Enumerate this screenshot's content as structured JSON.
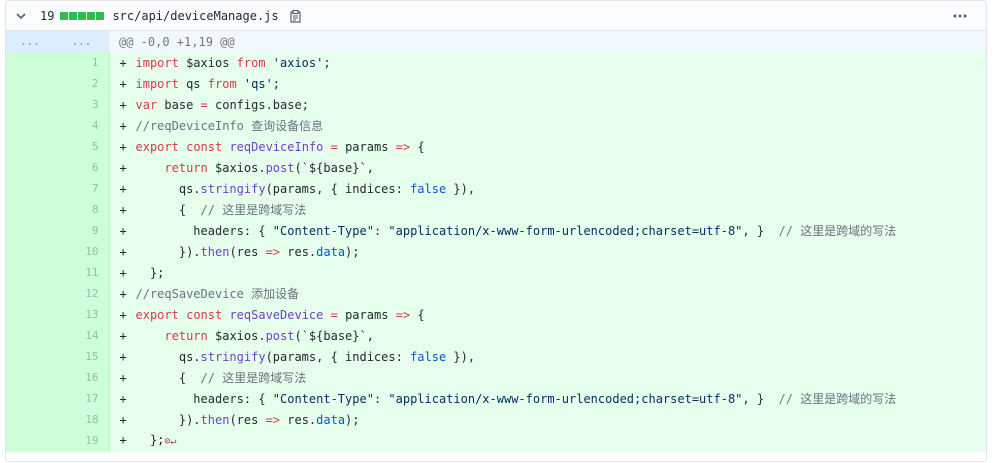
{
  "file": {
    "changes_count": "19",
    "filename": "src/api/deviceManage.js",
    "diffstat_colors": [
      "#2cbe4e",
      "#2cbe4e",
      "#2cbe4e",
      "#2cbe4e",
      "#2cbe4e"
    ]
  },
  "hunk": {
    "old_expand": "...",
    "new_expand": "...",
    "header": "@@ -0,0 +1,19 @@"
  },
  "lines": [
    {
      "n": "1",
      "tokens": [
        [
          "k",
          "import"
        ],
        [
          "",
          "",
          " $axios "
        ],
        [
          "k",
          "from"
        ],
        [
          "s",
          " 'axios'"
        ],
        [
          "",
          ";"
        ]
      ]
    },
    {
      "n": "2",
      "tokens": [
        [
          "k",
          "import"
        ],
        [
          "",
          " qs "
        ],
        [
          "k",
          "from"
        ],
        [
          "s",
          " 'qs'"
        ],
        [
          "",
          ";"
        ]
      ]
    },
    {
      "n": "3",
      "tokens": [
        [
          "k",
          "var"
        ],
        [
          "",
          " base "
        ],
        [
          "k",
          "="
        ],
        [
          "",
          " configs.base;"
        ]
      ]
    },
    {
      "n": "4",
      "tokens": [
        [
          "c",
          "//reqDeviceInfo 查询设备信息"
        ]
      ]
    },
    {
      "n": "5",
      "tokens": [
        [
          "k",
          "export"
        ],
        [
          "",
          " "
        ],
        [
          "k",
          "const"
        ],
        [
          "",
          " "
        ],
        [
          "f",
          "reqDeviceInfo"
        ],
        [
          "",
          " "
        ],
        [
          "k",
          "="
        ],
        [
          "",
          " params "
        ],
        [
          "k",
          "=>"
        ],
        [
          "",
          " {"
        ]
      ]
    },
    {
      "n": "6",
      "tokens": [
        [
          "",
          "    "
        ],
        [
          "k",
          "return"
        ],
        [
          "",
          " $axios."
        ],
        [
          "f",
          "post"
        ],
        [
          "",
          "(`${base}`,"
        ]
      ]
    },
    {
      "n": "7",
      "tokens": [
        [
          "",
          "      qs."
        ],
        [
          "f",
          "stringify"
        ],
        [
          "",
          "(params, { indices: "
        ],
        [
          "b",
          "false"
        ],
        [
          "",
          " }),"
        ]
      ]
    },
    {
      "n": "8",
      "tokens": [
        [
          "",
          "      {  "
        ],
        [
          "c",
          "// 这里是跨域写法"
        ]
      ]
    },
    {
      "n": "9",
      "tokens": [
        [
          "",
          "        headers: { "
        ],
        [
          "s",
          "\"Content-Type\""
        ],
        [
          "",
          ": "
        ],
        [
          "s",
          "\"application/x-www-form-urlencoded;charset=utf-8\""
        ],
        [
          "",
          ", }  "
        ],
        [
          "c",
          "// 这里是跨域的写法"
        ]
      ]
    },
    {
      "n": "10",
      "tokens": [
        [
          "",
          "      })."
        ],
        [
          "f",
          "then"
        ],
        [
          "",
          "(res "
        ],
        [
          "k",
          "=>"
        ],
        [
          "",
          " res."
        ],
        [
          "b",
          "data"
        ],
        [
          "",
          ");"
        ]
      ]
    },
    {
      "n": "11",
      "tokens": [
        [
          "",
          "  };"
        ]
      ]
    },
    {
      "n": "12",
      "tokens": [
        [
          "c",
          "//reqSaveDevice 添加设备"
        ]
      ]
    },
    {
      "n": "13",
      "tokens": [
        [
          "k",
          "export"
        ],
        [
          "",
          " "
        ],
        [
          "k",
          "const"
        ],
        [
          "",
          " "
        ],
        [
          "f",
          "reqSaveDevice"
        ],
        [
          "",
          " "
        ],
        [
          "k",
          "="
        ],
        [
          "",
          " params "
        ],
        [
          "k",
          "=>"
        ],
        [
          "",
          " {"
        ]
      ]
    },
    {
      "n": "14",
      "tokens": [
        [
          "",
          "    "
        ],
        [
          "k",
          "return"
        ],
        [
          "",
          " $axios."
        ],
        [
          "f",
          "post"
        ],
        [
          "",
          "(`${base}`,"
        ]
      ]
    },
    {
      "n": "15",
      "tokens": [
        [
          "",
          "      qs."
        ],
        [
          "f",
          "stringify"
        ],
        [
          "",
          "(params, { indices: "
        ],
        [
          "b",
          "false"
        ],
        [
          "",
          " }),"
        ]
      ]
    },
    {
      "n": "16",
      "tokens": [
        [
          "",
          "      {  "
        ],
        [
          "c",
          "// 这里是跨域写法"
        ]
      ]
    },
    {
      "n": "17",
      "tokens": [
        [
          "",
          "        headers: { "
        ],
        [
          "s",
          "\"Content-Type\""
        ],
        [
          "",
          ": "
        ],
        [
          "s",
          "\"application/x-www-form-urlencoded;charset=utf-8\""
        ],
        [
          "",
          ", }  "
        ],
        [
          "c",
          "// 这里是跨域的写法"
        ]
      ]
    },
    {
      "n": "18",
      "tokens": [
        [
          "",
          "      })."
        ],
        [
          "f",
          "then"
        ],
        [
          "",
          "(res "
        ],
        [
          "k",
          "=>"
        ],
        [
          "",
          " res."
        ],
        [
          "b",
          "data"
        ],
        [
          "",
          ");"
        ]
      ]
    },
    {
      "n": "19",
      "tokens": [
        [
          "",
          "  };"
        ],
        [
          "eof",
          "⊘↵"
        ]
      ]
    }
  ],
  "marker": "+",
  "icons": {
    "collapse": "chevron-down-icon",
    "copy": "clipboard-icon",
    "menu": "kebab-horizontal-icon",
    "eof": "no-newline-icon"
  }
}
